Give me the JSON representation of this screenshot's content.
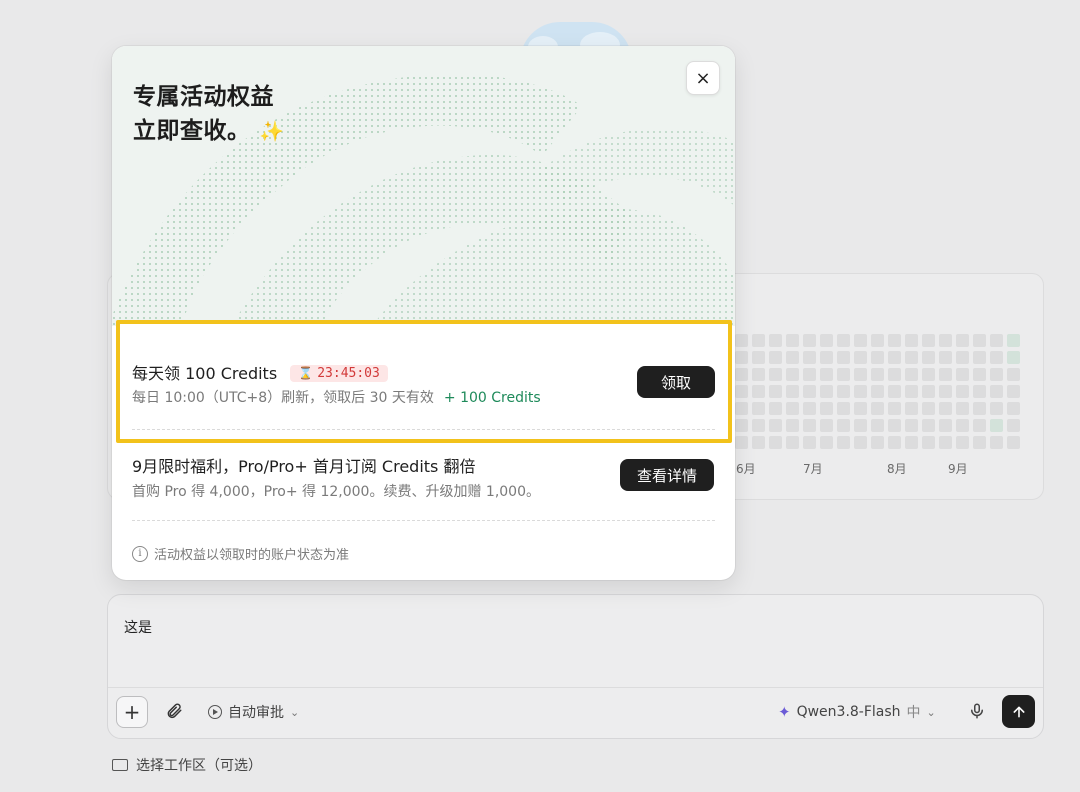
{
  "modal": {
    "title_line1": "专属活动权益",
    "title_line2": "立即查收。",
    "close_label": "×",
    "offers": [
      {
        "title": "每天领 100 Credits",
        "timer": "23:45:03",
        "subtitle": "每日 10:00（UTC+8）刷新，领取后 30 天有效",
        "credit": "+ 100 Credits",
        "button": "领取"
      },
      {
        "title": "9月限时福利，Pro/Pro+ 首月订阅 Credits 翻倍",
        "subtitle": "首购 Pro 得 4,000，Pro+ 得 12,000。续费、升级加赠 1,000。",
        "button": "查看详情"
      }
    ],
    "footnote": "活动权益以领取时的账户状态为准"
  },
  "heatmap": {
    "months": [
      "6月",
      "7月",
      "8月",
      "9月"
    ]
  },
  "composer": {
    "input_value": "这是",
    "auto_approve_label": "自动审批",
    "model_name": "Qwen3.8-Flash",
    "model_tag": "中",
    "workspace_label": "选择工作区（可选）"
  },
  "colors": {
    "highlight": "#f2c21b",
    "credit_green": "#1e8a5a",
    "timer_red": "#d23a3a",
    "button_dark": "#1f1f1f"
  }
}
